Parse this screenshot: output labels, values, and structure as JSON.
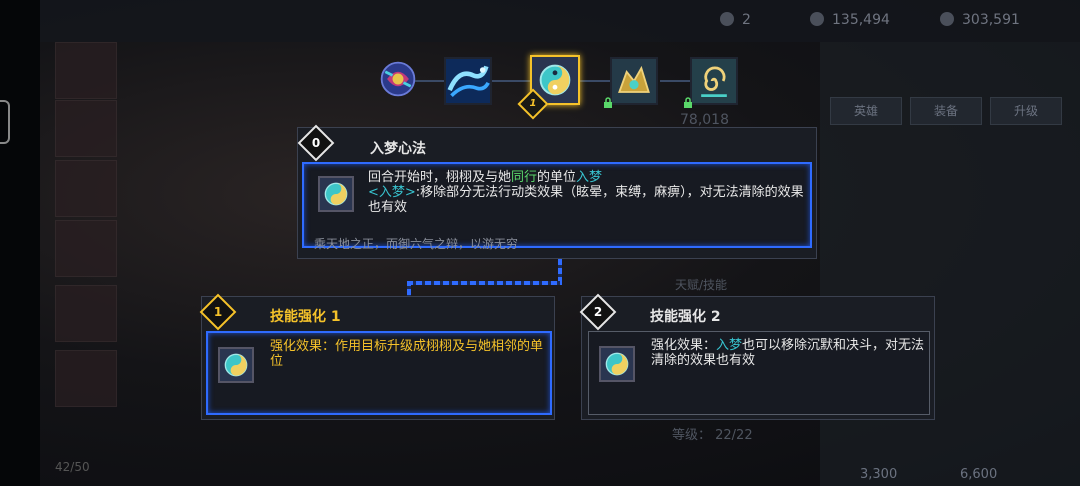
{
  "background": {
    "resources": [
      {
        "value": "2",
        "icon": "gem-icon"
      },
      {
        "value": "135,494",
        "icon": "coin-icon"
      },
      {
        "value": "303,591",
        "icon": "gold-icon"
      }
    ],
    "tabs": [
      "英雄",
      "装备",
      "升级"
    ],
    "power": "78,018",
    "skill_label": "天赋/技能",
    "level_text": "等级： 22/22",
    "cost_a": "3,300",
    "cost_b": "6,600",
    "roster_count": "42/50"
  },
  "skills": [
    {
      "name": "skill-1",
      "locked": false
    },
    {
      "name": "skill-2",
      "locked": false
    },
    {
      "name": "skill-3",
      "locked": false,
      "selected": true,
      "level": "1"
    },
    {
      "name": "skill-4",
      "locked": true
    },
    {
      "name": "skill-5",
      "locked": true
    }
  ],
  "main_skill": {
    "level": "0",
    "title": "入梦心法",
    "desc_prefix": "回合开始时，栩栩及与她",
    "desc_highlight1": "同行",
    "desc_mid": "的单位",
    "desc_highlight2": "入梦",
    "desc_tag": "<入梦>",
    "desc_rest": ":移除部分无法行动类效果（眩晕，束缚，麻痹），对无法清除的效果也有效",
    "flavor": "乘天地之正，而御六气之辩，以游无穷"
  },
  "upgrade1": {
    "level": "1",
    "title": "技能强化 1",
    "desc": "强化效果：作用目标升级成栩栩及与她相邻的单位"
  },
  "upgrade2": {
    "level": "2",
    "title": "技能强化 2",
    "desc_prefix": "强化效果：",
    "desc_highlight": "入梦",
    "desc_rest": "也可以移除沉默和决斗，对无法清除的效果也有效"
  },
  "colors": {
    "gold": "#f5c22a",
    "blue": "#2f6bff",
    "teal": "#38c4d0",
    "green": "#5ad76a"
  }
}
